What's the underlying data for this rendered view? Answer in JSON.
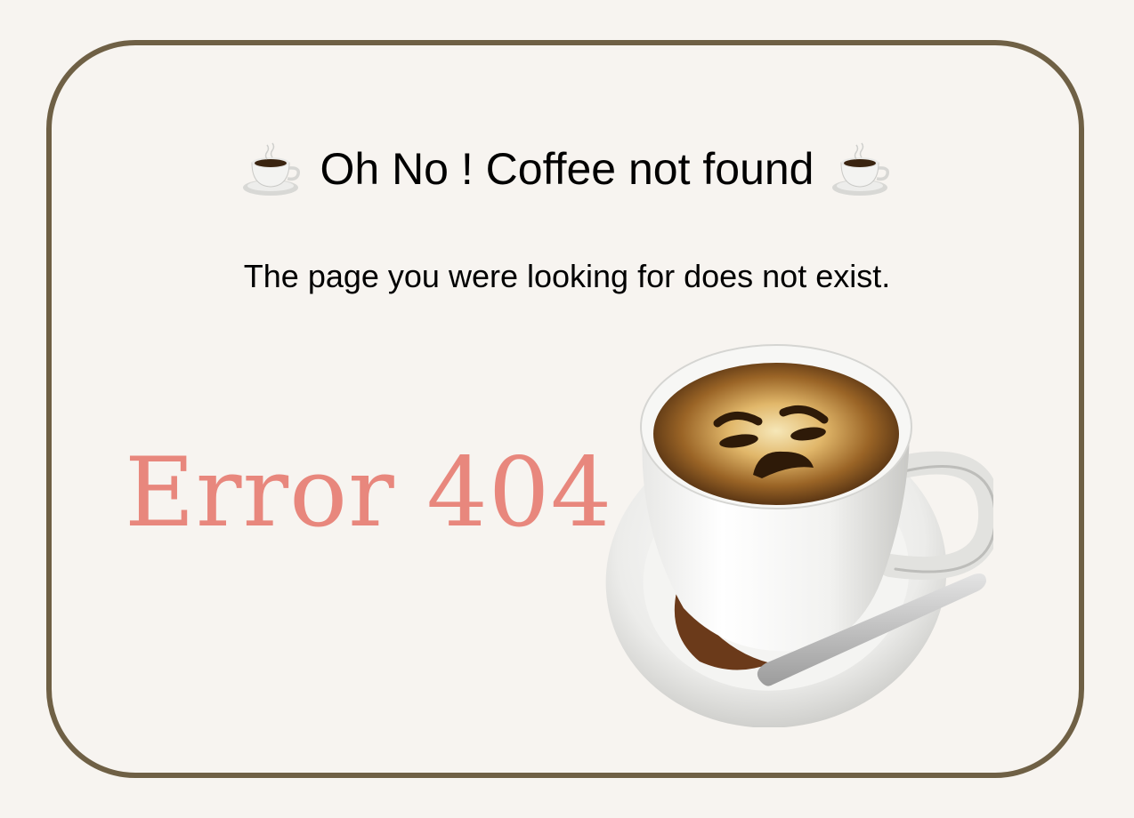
{
  "page": {
    "title": "Oh No ! Coffee not found",
    "title_icon": "coffee-cup-icon",
    "message": "The page you were looking for does not exist.",
    "error_code": "Error 404",
    "illustration": "sad-coffee-cup-icon"
  },
  "colors": {
    "background": "#f7f4f0",
    "border": "#6f6045",
    "error_text": "#e8877d",
    "text": "#000000"
  }
}
